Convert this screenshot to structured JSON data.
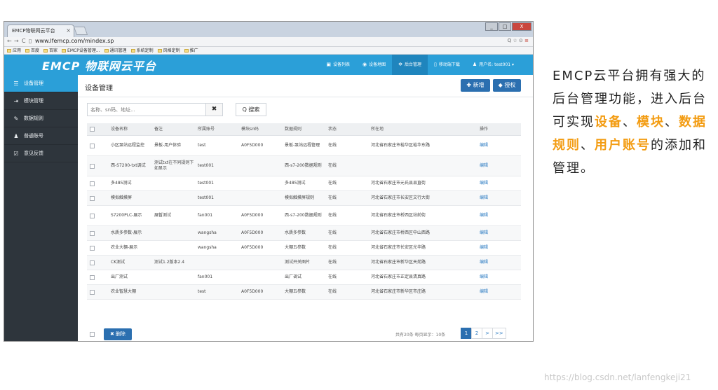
{
  "browser": {
    "tab_title": "EMCP物联网云平台",
    "tab_close": "×",
    "url": "www.lfemcp.com/mindex.sp",
    "window_buttons": [
      "_",
      "□",
      "X"
    ],
    "addr_right": "Q ☆ ⊙",
    "bookmarks": [
      "应用",
      "百度",
      "百家",
      "EMCP设备管理...",
      "通讯管理",
      "系统定制",
      "风格定制",
      "推广"
    ]
  },
  "app": {
    "logo": "EMCP 物联网云平台",
    "topnav": [
      {
        "icon": "▣",
        "label": "设备列表"
      },
      {
        "icon": "◉",
        "label": "设备地图"
      },
      {
        "icon": "✲",
        "label": "后台管理"
      },
      {
        "icon": "▯",
        "label": "移动端下载"
      },
      {
        "icon": "♟",
        "label": "用户名: test001 ▾"
      }
    ],
    "sidebar": [
      {
        "icon": "☰",
        "label": "设备管理"
      },
      {
        "icon": "⇥",
        "label": "模块管理"
      },
      {
        "icon": "✎",
        "label": "数据规则"
      },
      {
        "icon": "♟",
        "label": "普通账号"
      },
      {
        "icon": "☑",
        "label": "意见反馈"
      }
    ]
  },
  "main": {
    "title": "设备管理",
    "add_label": "✚ 新增",
    "grant_label": "◆ 授权",
    "search_placeholder": "名称、sn码、地址...",
    "clear_label": "✖",
    "search_label": "Q 搜索",
    "columns": [
      "设备名称",
      "备注",
      "所属账号",
      "模块sn码",
      "数据规则",
      "状态",
      "所在地",
      "操作"
    ],
    "rows": [
      [
        "小区泵站远程监控",
        "景板-用户体验",
        "test",
        "A0F5D000",
        "景板-泵站远程管理",
        "在线",
        "河北省石家庄市裕华区裕华东路",
        "编辑"
      ],
      [
        "西-S7200-txt调试",
        "测试txt在不同规则下如显示",
        "test001",
        "",
        "西-s7-200数据规则",
        "在线",
        "",
        "编辑"
      ],
      [
        "多485测试",
        "",
        "test001",
        "",
        "多485测试",
        "在线",
        "河北省石家庄市元氏县县直街",
        "编辑"
      ],
      [
        "模拟触摸屏",
        "",
        "test001",
        "",
        "模拟触摸屏规则",
        "在线",
        "河北省石家庄市长安区文行大街",
        "编辑"
      ],
      [
        "S7200PLC-展示",
        "展暂测试",
        "fan001",
        "A0F5D000",
        "西-s7-200数据规则",
        "在线",
        "河北省石家庄市桥西区站前街",
        "编辑"
      ],
      [
        "水质多参数-展示",
        "",
        "wangsha",
        "A0F5D000",
        "水质多参数",
        "在线",
        "河北省石家庄市桥西区中山西路",
        "编辑"
      ],
      [
        "农业大棚-展示",
        "",
        "wangsha",
        "A0F5D000",
        "大棚五参数",
        "在线",
        "河北省石家庄市长安区光华路",
        "编辑"
      ],
      [
        "CK测试",
        "测试1.2版本2.4",
        "",
        "",
        "测试开关图片",
        "在线",
        "河北省石家庄市新华区天苑路",
        "编辑"
      ],
      [
        "出厂测试",
        "",
        "fan001",
        "",
        "出厂调试",
        "在线",
        "河北省石家庄市正定县清真路",
        "编辑"
      ],
      [
        "农业智慧大棚",
        "",
        "test",
        "A0F5D000",
        "大棚五参数",
        "在线",
        "河北省石家庄市新华区市庄路",
        "编辑"
      ]
    ],
    "delete_label": "✖ 删除",
    "page_info": "共有20条  每页显示：10条",
    "pages": [
      "1",
      "2",
      ">",
      ">>"
    ]
  },
  "caption": {
    "text_1": "EMCP云平台拥有强大的后台管理功能，进入后台可实现",
    "hl_1": "设备",
    "sep_1": "、",
    "hl_2": "模块",
    "sep_2": "、",
    "hl_3": "数据规则",
    "sep_3": "、",
    "hl_4": "用户账号",
    "text_2": "的添加和管理。"
  },
  "watermark": "https://blog.csdn.net/lanfengkeji21",
  "colors": {
    "topbar": "#2b9fd8",
    "sidebar": "#2e353c",
    "primary_button": "#2b6fb0",
    "highlight": "#f39c12"
  }
}
